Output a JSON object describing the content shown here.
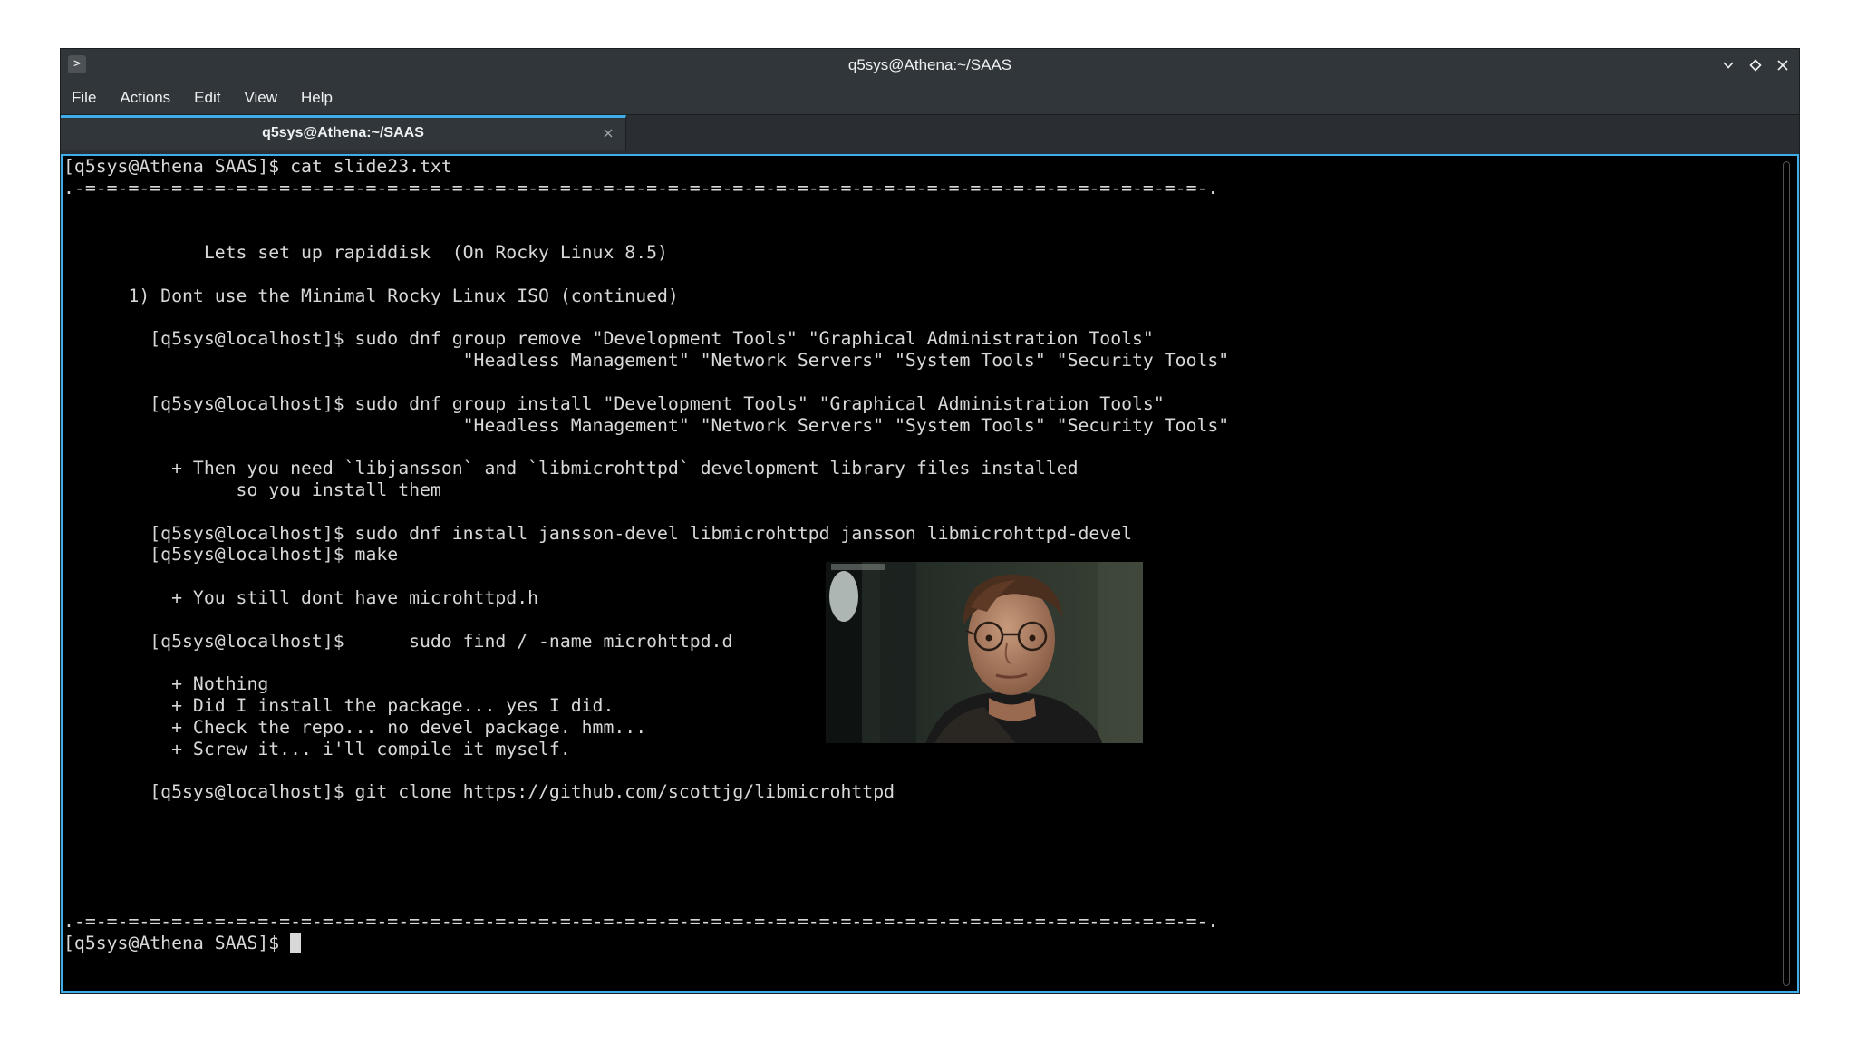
{
  "window": {
    "title": "q5sys@Athena:~/SAAS",
    "icons": {
      "app": "terminal-app-icon",
      "minimize": "chevron-down-icon",
      "maximize": "diamond-icon",
      "close": "close-icon"
    }
  },
  "menu": {
    "file": "File",
    "actions": "Actions",
    "edit": "Edit",
    "view": "View",
    "help": "Help"
  },
  "tab": {
    "label": "q5sys@Athena:~/SAAS",
    "close_icon": "close-icon"
  },
  "terminal": {
    "lines": [
      "[q5sys@Athena SAAS]$ cat slide23.txt",
      ".-=-=-=-=-=-=-=-=-=-=-=-=-=-=-=-=-=-=-=-=-=-=-=-=-=-=-=-=-=-=-=-=-=-=-=-=-=-=-=-=-=-=-=-=-=-=-=-=-=-=-=-=-.",
      "",
      "",
      "             Lets set up rapiddisk  (On Rocky Linux 8.5)",
      "",
      "      1) Dont use the Minimal Rocky Linux ISO (continued)",
      "",
      "        [q5sys@localhost]$ sudo dnf group remove \"Development Tools\" \"Graphical Administration Tools\"",
      "                                     \"Headless Management\" \"Network Servers\" \"System Tools\" \"Security Tools\"",
      "",
      "        [q5sys@localhost]$ sudo dnf group install \"Development Tools\" \"Graphical Administration Tools\"",
      "                                     \"Headless Management\" \"Network Servers\" \"System Tools\" \"Security Tools\"",
      "",
      "          + Then you need `libjansson` and `libmicrohttpd` development library files installed",
      "                so you install them",
      "",
      "        [q5sys@localhost]$ sudo dnf install jansson-devel libmicrohttpd jansson libmicrohttpd-devel",
      "        [q5sys@localhost]$ make",
      "",
      "          + You still dont have microhttpd.h",
      "",
      "        [q5sys@localhost]$      sudo find / -name microhttpd.d",
      "",
      "          + Nothing",
      "          + Did I install the package... yes I did.",
      "          + Check the repo... no devel package. hmm...",
      "          + Screw it... i'll compile it myself.",
      "",
      "        [q5sys@localhost]$ git clone https://github.com/scottjg/libmicrohttpd",
      "",
      "",
      "",
      "",
      "",
      ".-=-=-=-=-=-=-=-=-=-=-=-=-=-=-=-=-=-=-=-=-=-=-=-=-=-=-=-=-=-=-=-=-=-=-=-=-=-=-=-=-=-=-=-=-=-=-=-=-=-=-=-=-."
    ],
    "prompt": "[q5sys@Athena SAAS]$ "
  },
  "image": {
    "description_icon": "person-with-glasses-photo"
  },
  "colors": {
    "accent": "#3daee9",
    "chrome": "#31363b",
    "terminal_bg": "#000000",
    "terminal_fg": "#d8d8d8"
  }
}
